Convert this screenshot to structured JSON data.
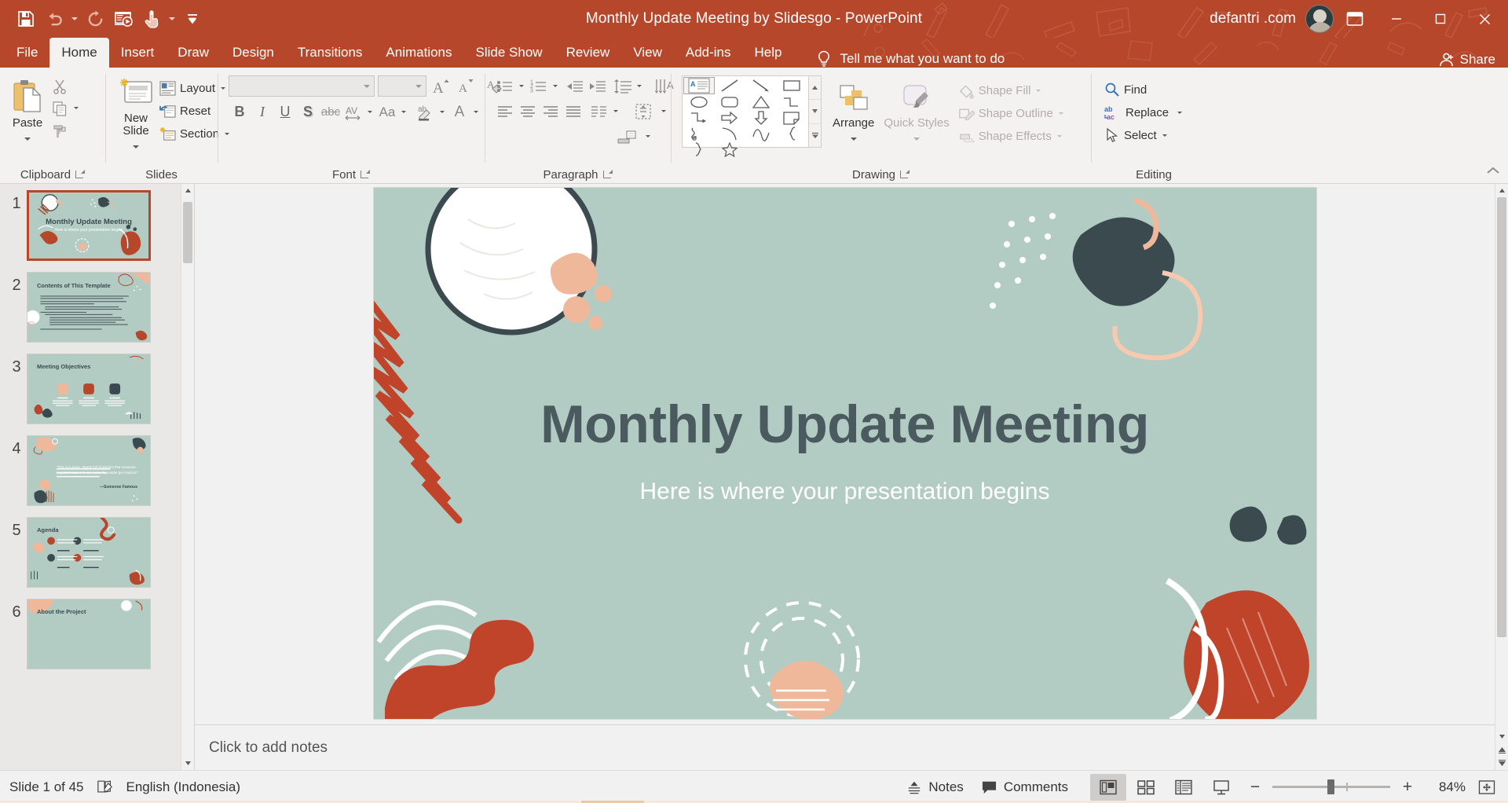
{
  "app": {
    "title": "Monthly Update Meeting by Slidesgo  -  PowerPoint",
    "account": "defantri .com",
    "accent_color": "#b7472a",
    "ribbon_bg": "#f3f2f1"
  },
  "quick_access": [
    {
      "name": "save-icon",
      "label": "Save"
    },
    {
      "name": "undo-icon",
      "label": "Undo"
    },
    {
      "name": "redo-icon",
      "label": "Redo"
    },
    {
      "name": "start-from-beginning-icon",
      "label": "Start From Beginning"
    },
    {
      "name": "touch-mouse-mode-icon",
      "label": "Touch/Mouse Mode"
    },
    {
      "name": "customize-quick-access-toolbar-icon",
      "label": "Customize Quick Access Toolbar"
    }
  ],
  "window_controls": [
    {
      "name": "minimize-button",
      "glyph": "–"
    },
    {
      "name": "restore-button",
      "glyph": "❐"
    },
    {
      "name": "close-button",
      "glyph": "✕"
    }
  ],
  "ribbon_display_options": "ribbon-display-options-icon",
  "tabs": [
    {
      "label": "File",
      "active": false
    },
    {
      "label": "Home",
      "active": true
    },
    {
      "label": "Insert",
      "active": false
    },
    {
      "label": "Draw",
      "active": false
    },
    {
      "label": "Design",
      "active": false
    },
    {
      "label": "Transitions",
      "active": false
    },
    {
      "label": "Animations",
      "active": false
    },
    {
      "label": "Slide Show",
      "active": false
    },
    {
      "label": "Review",
      "active": false
    },
    {
      "label": "View",
      "active": false
    },
    {
      "label": "Add-ins",
      "active": false
    },
    {
      "label": "Help",
      "active": false
    }
  ],
  "tell_me": "Tell me what you want to do",
  "share": "Share",
  "ribbon": {
    "groups": [
      {
        "label": "Clipboard",
        "has_launcher": true
      },
      {
        "label": "Slides",
        "has_launcher": false
      },
      {
        "label": "Font",
        "has_launcher": true
      },
      {
        "label": "Paragraph",
        "has_launcher": true
      },
      {
        "label": "Drawing",
        "has_launcher": true
      },
      {
        "label": "Editing",
        "has_launcher": false
      }
    ],
    "clipboard": {
      "paste": "Paste",
      "cut": "Cut",
      "copy": "Copy",
      "format_painter": "Format Painter"
    },
    "slides": {
      "new_slide": "New Slide",
      "layout": "Layout",
      "reset": "Reset",
      "section": "Section"
    },
    "font": {
      "font_name_value": "",
      "font_size_value": "",
      "bold": "B",
      "italic": "I",
      "underline": "U",
      "shadow": "S",
      "strikethrough": "abc",
      "char_spacing": "AV",
      "change_case": "Aa",
      "increase_font_size": "A",
      "decrease_font_size": "A",
      "clear_formatting": "Clear All Formatting",
      "text_highlight": "Text Highlight Color",
      "font_color": "A"
    },
    "paragraph": {
      "bullets": "Bullets",
      "numbering": "Numbering",
      "decrease_indent": "Decrease List Level",
      "increase_indent": "Increase List Level",
      "line_spacing": "Line Spacing",
      "text_direction": "Text Direction",
      "align_text": "Align Text",
      "convert_to_smartart": "Convert to SmartArt",
      "align_left": "Align Left",
      "align_center": "Center",
      "align_right": "Align Right",
      "justify": "Justify",
      "columns": "Columns"
    },
    "drawing": {
      "arrange": "Arrange",
      "quick_styles": "Quick Styles",
      "shape_fill": "Shape Fill",
      "shape_outline": "Shape Outline",
      "shape_effects": "Shape Effects",
      "shapes": [
        "text-box",
        "line",
        "arrow-line",
        "elbow-arrow",
        "rectangle",
        "oval",
        "rounded-rectangle",
        "right-arrow",
        "triangle",
        "elbow-connector",
        "curved-arrow",
        "freeform",
        "down-arrow",
        "flowchart-shape",
        "scribble",
        "arc",
        "left-brace",
        "right-brace",
        "star",
        "wave"
      ]
    },
    "editing": {
      "find": "Find",
      "replace": "Replace",
      "select": "Select"
    }
  },
  "slides_panel": [
    {
      "number": "1",
      "selected": true,
      "title": "Monthly Update Meeting",
      "subtitle": "Here is where your presentation begins"
    },
    {
      "number": "2",
      "selected": false,
      "title": "Contents of This Template",
      "subtitle": ""
    },
    {
      "number": "3",
      "selected": false,
      "title": "Meeting Objectives",
      "subtitle": ""
    },
    {
      "number": "4",
      "selected": false,
      "title": "“This is a quote. Words full of wisdom that someone important said and can make the reader get inspired.”",
      "subtitle": "—Someone Famous"
    },
    {
      "number": "5",
      "selected": false,
      "title": "Agenda",
      "subtitle": ""
    },
    {
      "number": "6",
      "selected": false,
      "title": "About the Project",
      "subtitle": ""
    }
  ],
  "slide_3_cards": [
    {
      "title": "Mars",
      "body": "Despite being red, Mars is a cold place. It’s full of iron oxide dust"
    },
    {
      "title": "Jupiter",
      "body": "Jupiter is the biggest planet in our Solar System and the fourth-brightest"
    },
    {
      "title": "Venus",
      "body": "It has a beautiful name, but it’s terribly hot, even hotter than Mercury"
    }
  ],
  "current_slide": {
    "title": "Monthly Update Meeting",
    "subtitle": "Here is where your presentation begins",
    "background_color": "#b3ccc3"
  },
  "notes_placeholder": "Click to add notes",
  "status_bar": {
    "slide_indicator": "Slide 1 of 45",
    "language": "English (Indonesia)",
    "accessibility_icon": "spelling-check-icon",
    "notes": "Notes",
    "comments": "Comments",
    "views": [
      {
        "name": "normal-view-button",
        "label": "Normal",
        "active": true
      },
      {
        "name": "slide-sorter-view-button",
        "label": "Slide Sorter",
        "active": false
      },
      {
        "name": "reading-view-button",
        "label": "Reading View",
        "active": false
      },
      {
        "name": "slide-show-button",
        "label": "Slide Show",
        "active": false
      }
    ],
    "zoom_out": "−",
    "zoom_in": "+",
    "zoom_value": "84%",
    "fit_to_window": "Fit slide to current window"
  }
}
